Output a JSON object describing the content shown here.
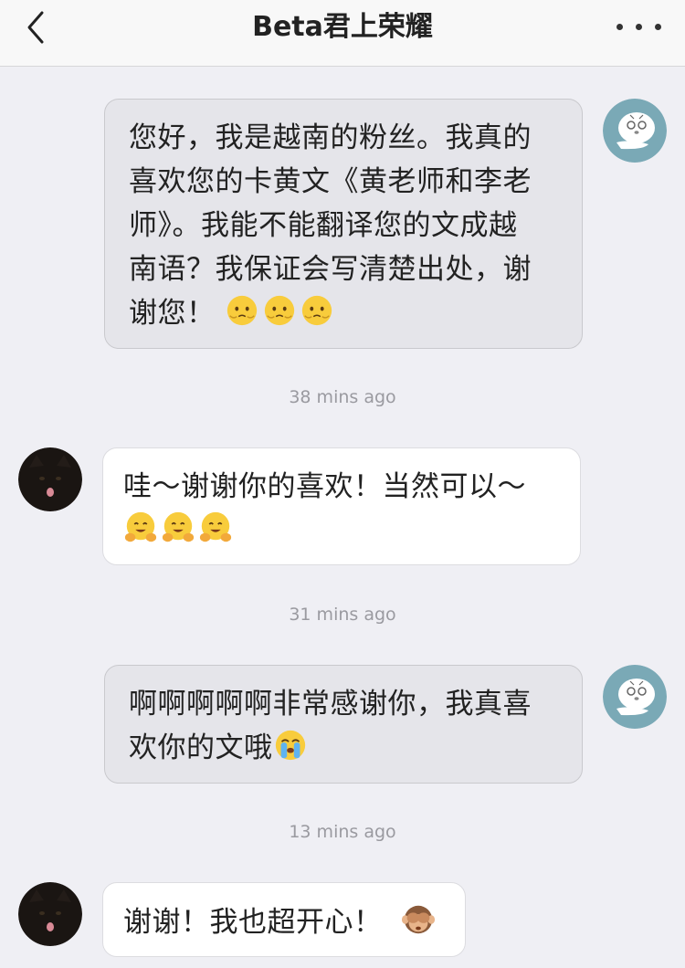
{
  "header": {
    "title": "Beta君上荣耀"
  },
  "messages": [
    {
      "side": "sent",
      "lines": [
        "您好，我是越南的粉丝。我真的",
        "喜欢您的卡黄文《黄老师和李老",
        "师》。我能不能翻译您的文成越",
        "南语？我保证会写清楚出处，谢",
        "谢您！"
      ],
      "emoji": "hushed-face-icon"
    },
    {
      "time": "38 mins ago"
    },
    {
      "side": "recv",
      "lines": [
        "哇～谢谢你的喜欢！当然可以～"
      ],
      "emoji": "hugging-face-icon"
    },
    {
      "time": "31 mins ago"
    },
    {
      "side": "sent",
      "lines": [
        "啊啊啊啊啊非常感谢你，我真喜",
        "欢你的文哦"
      ],
      "emoji": "crying-face-icon"
    },
    {
      "time": "13 mins ago"
    },
    {
      "side": "recv",
      "lines": [
        "谢谢！我也超开心！"
      ],
      "emoji": "see-no-evil-monkey-icon"
    }
  ]
}
